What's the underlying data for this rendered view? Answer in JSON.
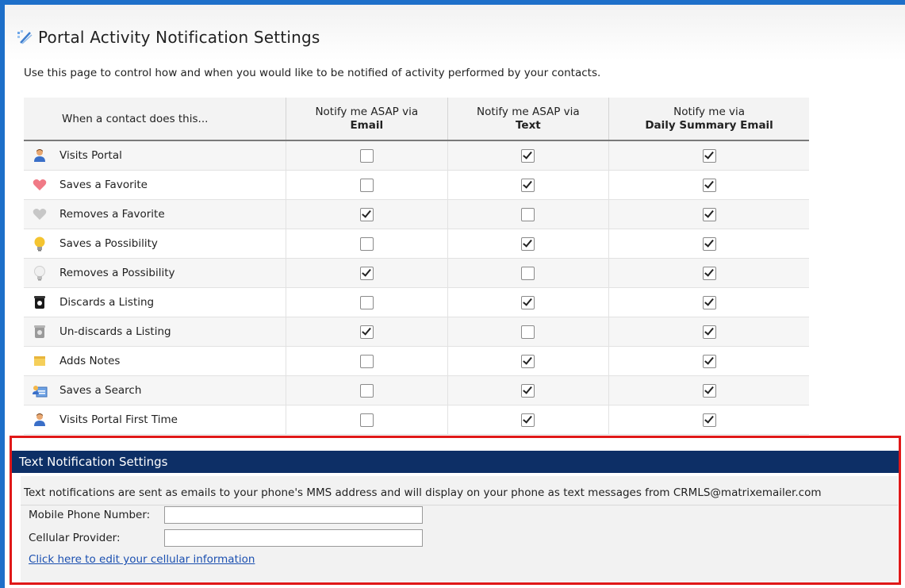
{
  "page": {
    "title": "Portal Activity Notification Settings",
    "intro": "Use this page to control how and when you would like to be notified of activity performed by your contacts."
  },
  "table": {
    "headers": [
      {
        "top": "When a contact does this...",
        "strong": ""
      },
      {
        "top": "Notify me ASAP via",
        "strong": "Email"
      },
      {
        "top": "Notify me ASAP via",
        "strong": "Text"
      },
      {
        "top": "Notify me via",
        "strong": "Daily Summary Email"
      }
    ],
    "rows": [
      {
        "label": "Visits Portal",
        "icon": "person-icon",
        "email": false,
        "text": true,
        "summary": true
      },
      {
        "label": "Saves a Favorite",
        "icon": "heart-icon",
        "email": false,
        "text": true,
        "summary": true
      },
      {
        "label": "Removes a Favorite",
        "icon": "heart-gray-icon",
        "email": true,
        "text": false,
        "summary": true
      },
      {
        "label": "Saves a Possibility",
        "icon": "lightbulb-icon",
        "email": false,
        "text": true,
        "summary": true
      },
      {
        "label": "Removes a Possibility",
        "icon": "lightbulb-gray-icon",
        "email": true,
        "text": false,
        "summary": true
      },
      {
        "label": "Discards a Listing",
        "icon": "trash-icon",
        "email": false,
        "text": true,
        "summary": true
      },
      {
        "label": "Un-discards a Listing",
        "icon": "trash-gray-icon",
        "email": true,
        "text": false,
        "summary": true
      },
      {
        "label": "Adds Notes",
        "icon": "note-icon",
        "email": false,
        "text": true,
        "summary": true
      },
      {
        "label": "Saves a Search",
        "icon": "search-save-icon",
        "email": false,
        "text": true,
        "summary": true
      },
      {
        "label": "Visits Portal First Time",
        "icon": "person-icon",
        "email": false,
        "text": true,
        "summary": true
      }
    ]
  },
  "text_settings": {
    "header": "Text Notification Settings",
    "description": "Text notifications are sent as emails to your phone's MMS address and will display on your phone as text messages from CRMLS@matrixemailer.com",
    "mobile_label": "Mobile Phone Number:",
    "mobile_value": "",
    "provider_label": "Cellular Provider:",
    "provider_value": "",
    "edit_link": "Click here to edit your cellular information"
  },
  "colors": {
    "frame": "#1d6fc9",
    "header_bar": "#0d2f66",
    "highlight_border": "#e01818",
    "link": "#1a4fb0"
  }
}
